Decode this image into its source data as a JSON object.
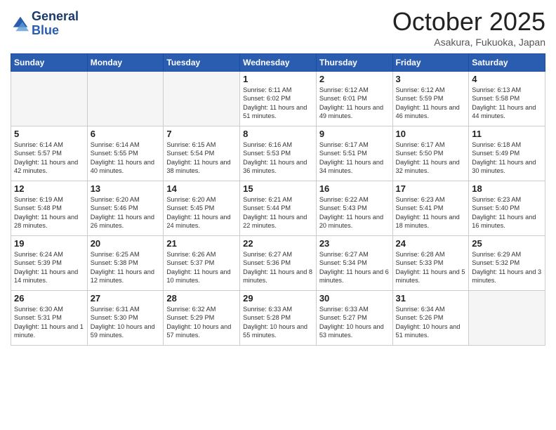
{
  "header": {
    "logo_line1": "General",
    "logo_line2": "Blue",
    "month": "October 2025",
    "location": "Asakura, Fukuoka, Japan"
  },
  "days_of_week": [
    "Sunday",
    "Monday",
    "Tuesday",
    "Wednesday",
    "Thursday",
    "Friday",
    "Saturday"
  ],
  "weeks": [
    [
      {
        "day": "",
        "sunrise": "",
        "sunset": "",
        "daylight": "",
        "empty": true
      },
      {
        "day": "",
        "sunrise": "",
        "sunset": "",
        "daylight": "",
        "empty": true
      },
      {
        "day": "",
        "sunrise": "",
        "sunset": "",
        "daylight": "",
        "empty": true
      },
      {
        "day": "1",
        "sunrise": "Sunrise: 6:11 AM",
        "sunset": "Sunset: 6:02 PM",
        "daylight": "Daylight: 11 hours and 51 minutes."
      },
      {
        "day": "2",
        "sunrise": "Sunrise: 6:12 AM",
        "sunset": "Sunset: 6:01 PM",
        "daylight": "Daylight: 11 hours and 49 minutes."
      },
      {
        "day": "3",
        "sunrise": "Sunrise: 6:12 AM",
        "sunset": "Sunset: 5:59 PM",
        "daylight": "Daylight: 11 hours and 46 minutes."
      },
      {
        "day": "4",
        "sunrise": "Sunrise: 6:13 AM",
        "sunset": "Sunset: 5:58 PM",
        "daylight": "Daylight: 11 hours and 44 minutes."
      }
    ],
    [
      {
        "day": "5",
        "sunrise": "Sunrise: 6:14 AM",
        "sunset": "Sunset: 5:57 PM",
        "daylight": "Daylight: 11 hours and 42 minutes."
      },
      {
        "day": "6",
        "sunrise": "Sunrise: 6:14 AM",
        "sunset": "Sunset: 5:55 PM",
        "daylight": "Daylight: 11 hours and 40 minutes."
      },
      {
        "day": "7",
        "sunrise": "Sunrise: 6:15 AM",
        "sunset": "Sunset: 5:54 PM",
        "daylight": "Daylight: 11 hours and 38 minutes."
      },
      {
        "day": "8",
        "sunrise": "Sunrise: 6:16 AM",
        "sunset": "Sunset: 5:53 PM",
        "daylight": "Daylight: 11 hours and 36 minutes."
      },
      {
        "day": "9",
        "sunrise": "Sunrise: 6:17 AM",
        "sunset": "Sunset: 5:51 PM",
        "daylight": "Daylight: 11 hours and 34 minutes."
      },
      {
        "day": "10",
        "sunrise": "Sunrise: 6:17 AM",
        "sunset": "Sunset: 5:50 PM",
        "daylight": "Daylight: 11 hours and 32 minutes."
      },
      {
        "day": "11",
        "sunrise": "Sunrise: 6:18 AM",
        "sunset": "Sunset: 5:49 PM",
        "daylight": "Daylight: 11 hours and 30 minutes."
      }
    ],
    [
      {
        "day": "12",
        "sunrise": "Sunrise: 6:19 AM",
        "sunset": "Sunset: 5:48 PM",
        "daylight": "Daylight: 11 hours and 28 minutes."
      },
      {
        "day": "13",
        "sunrise": "Sunrise: 6:20 AM",
        "sunset": "Sunset: 5:46 PM",
        "daylight": "Daylight: 11 hours and 26 minutes."
      },
      {
        "day": "14",
        "sunrise": "Sunrise: 6:20 AM",
        "sunset": "Sunset: 5:45 PM",
        "daylight": "Daylight: 11 hours and 24 minutes."
      },
      {
        "day": "15",
        "sunrise": "Sunrise: 6:21 AM",
        "sunset": "Sunset: 5:44 PM",
        "daylight": "Daylight: 11 hours and 22 minutes."
      },
      {
        "day": "16",
        "sunrise": "Sunrise: 6:22 AM",
        "sunset": "Sunset: 5:43 PM",
        "daylight": "Daylight: 11 hours and 20 minutes."
      },
      {
        "day": "17",
        "sunrise": "Sunrise: 6:23 AM",
        "sunset": "Sunset: 5:41 PM",
        "daylight": "Daylight: 11 hours and 18 minutes."
      },
      {
        "day": "18",
        "sunrise": "Sunrise: 6:23 AM",
        "sunset": "Sunset: 5:40 PM",
        "daylight": "Daylight: 11 hours and 16 minutes."
      }
    ],
    [
      {
        "day": "19",
        "sunrise": "Sunrise: 6:24 AM",
        "sunset": "Sunset: 5:39 PM",
        "daylight": "Daylight: 11 hours and 14 minutes."
      },
      {
        "day": "20",
        "sunrise": "Sunrise: 6:25 AM",
        "sunset": "Sunset: 5:38 PM",
        "daylight": "Daylight: 11 hours and 12 minutes."
      },
      {
        "day": "21",
        "sunrise": "Sunrise: 6:26 AM",
        "sunset": "Sunset: 5:37 PM",
        "daylight": "Daylight: 11 hours and 10 minutes."
      },
      {
        "day": "22",
        "sunrise": "Sunrise: 6:27 AM",
        "sunset": "Sunset: 5:36 PM",
        "daylight": "Daylight: 11 hours and 8 minutes."
      },
      {
        "day": "23",
        "sunrise": "Sunrise: 6:27 AM",
        "sunset": "Sunset: 5:34 PM",
        "daylight": "Daylight: 11 hours and 6 minutes."
      },
      {
        "day": "24",
        "sunrise": "Sunrise: 6:28 AM",
        "sunset": "Sunset: 5:33 PM",
        "daylight": "Daylight: 11 hours and 5 minutes."
      },
      {
        "day": "25",
        "sunrise": "Sunrise: 6:29 AM",
        "sunset": "Sunset: 5:32 PM",
        "daylight": "Daylight: 11 hours and 3 minutes."
      }
    ],
    [
      {
        "day": "26",
        "sunrise": "Sunrise: 6:30 AM",
        "sunset": "Sunset: 5:31 PM",
        "daylight": "Daylight: 11 hours and 1 minute."
      },
      {
        "day": "27",
        "sunrise": "Sunrise: 6:31 AM",
        "sunset": "Sunset: 5:30 PM",
        "daylight": "Daylight: 10 hours and 59 minutes."
      },
      {
        "day": "28",
        "sunrise": "Sunrise: 6:32 AM",
        "sunset": "Sunset: 5:29 PM",
        "daylight": "Daylight: 10 hours and 57 minutes."
      },
      {
        "day": "29",
        "sunrise": "Sunrise: 6:33 AM",
        "sunset": "Sunset: 5:28 PM",
        "daylight": "Daylight: 10 hours and 55 minutes."
      },
      {
        "day": "30",
        "sunrise": "Sunrise: 6:33 AM",
        "sunset": "Sunset: 5:27 PM",
        "daylight": "Daylight: 10 hours and 53 minutes."
      },
      {
        "day": "31",
        "sunrise": "Sunrise: 6:34 AM",
        "sunset": "Sunset: 5:26 PM",
        "daylight": "Daylight: 10 hours and 51 minutes."
      },
      {
        "day": "",
        "sunrise": "",
        "sunset": "",
        "daylight": "",
        "empty": true
      }
    ]
  ]
}
